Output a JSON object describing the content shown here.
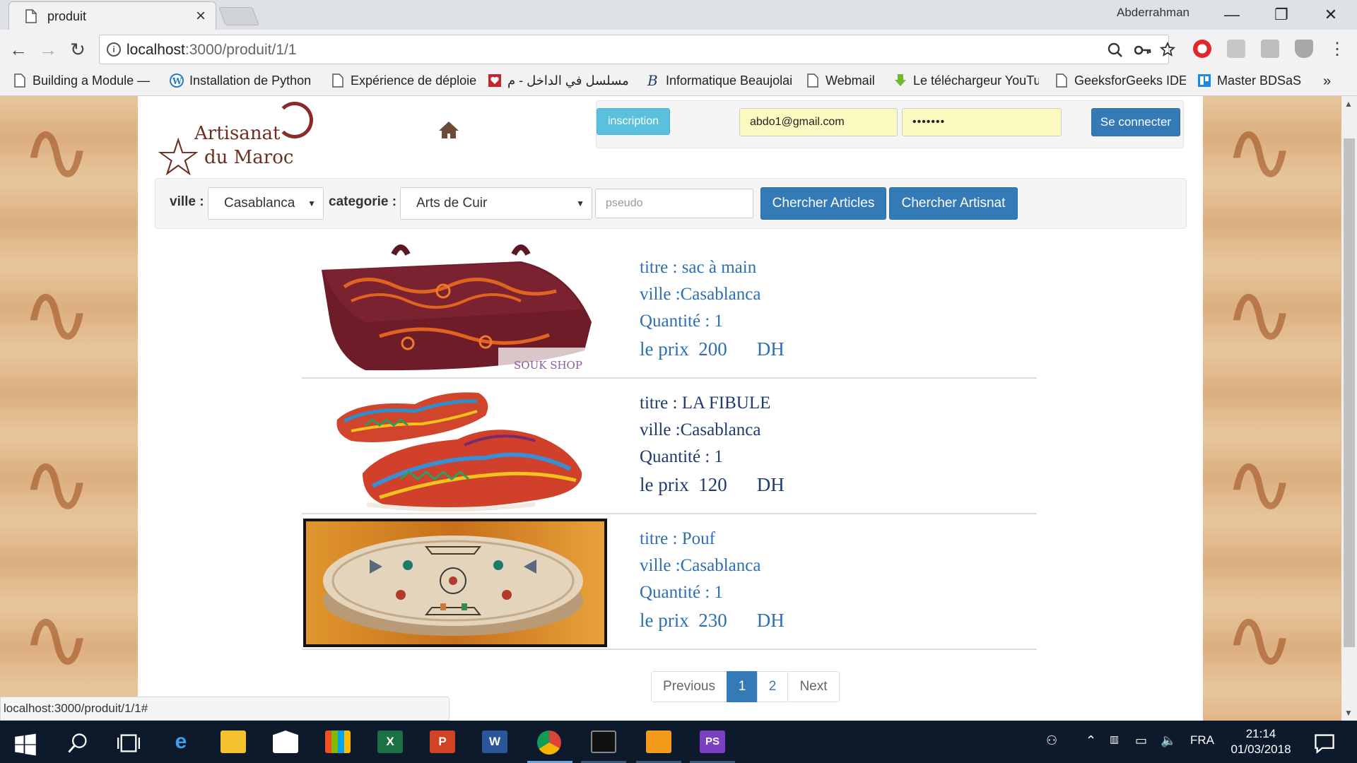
{
  "browser": {
    "tab_title": "produit",
    "tab_close": "×",
    "user_name": "Abderrahman",
    "url_host": "localhost",
    "url_path": ":3000/produit/1/1",
    "minimize": "—",
    "restore": "❐",
    "close": "✕",
    "overflow": "»",
    "bookmarks": [
      {
        "label": "Building a Module —",
        "icon": "page-icon"
      },
      {
        "label": "Installation de Python",
        "icon": "wordpress-icon"
      },
      {
        "label": "Expérience de déploie",
        "icon": "page-icon"
      },
      {
        "label": "مسلسل في الداخل - م",
        "icon": "heart-icon"
      },
      {
        "label": "Informatique Beaujolais",
        "icon": "b-logo-icon"
      },
      {
        "label": "Webmail",
        "icon": "page-icon"
      },
      {
        "label": "Le téléchargeur YouTube",
        "icon": "download-arrow-icon"
      },
      {
        "label": "GeeksforGeeks IDE",
        "icon": "page-icon"
      },
      {
        "label": "Master BDSaS",
        "icon": "trello-icon"
      }
    ],
    "status_url": "localhost:3000/produit/1/1#"
  },
  "header": {
    "logo_line1": "Artisanat",
    "logo_line2": "du Maroc",
    "inscription_label": "inscription",
    "email_value": "abdo1@gmail.com",
    "password_value": "•••••••",
    "connect_label": "Se connecter"
  },
  "search": {
    "ville_label": "ville :",
    "ville_value": "Casablanca",
    "categorie_label": "categorie :",
    "categorie_value": "Arts de Cuir",
    "pseudo_placeholder": "pseudo",
    "btn_articles": "Chercher Articles",
    "btn_artisanat": "Chercher Artisnat"
  },
  "products": [
    {
      "titre": "titre : sac à main",
      "ville": "ville :Casablanca",
      "quantite": "Quantité : 1",
      "prix_label": "le prix",
      "prix": "200",
      "devise": "DH",
      "image": "leather-bag",
      "watermark": "SOUK SHOP"
    },
    {
      "titre": "titre : LA FIBULE",
      "ville": "ville :Casablanca",
      "quantite": "Quantité : 1",
      "prix_label": "le prix",
      "prix": "120",
      "devise": "DH",
      "image": "babouche-slippers"
    },
    {
      "titre": "titre : Pouf",
      "ville": "ville :Casablanca",
      "quantite": "Quantité : 1",
      "prix_label": "le prix",
      "prix": "230",
      "devise": "DH",
      "image": "leather-pouf"
    }
  ],
  "pagination": {
    "previous": "Previous",
    "pages": [
      "1",
      "2"
    ],
    "current": "1",
    "next": "Next"
  },
  "taskbar": {
    "language": "FRA",
    "time": "21:14",
    "date": "01/03/2018"
  },
  "colors": {
    "primary": "#337ab7",
    "info": "#5bc0de",
    "product_text": "#2c6fb3",
    "autofill": "#fcfac0",
    "taskbar": "#0d1a2b"
  }
}
